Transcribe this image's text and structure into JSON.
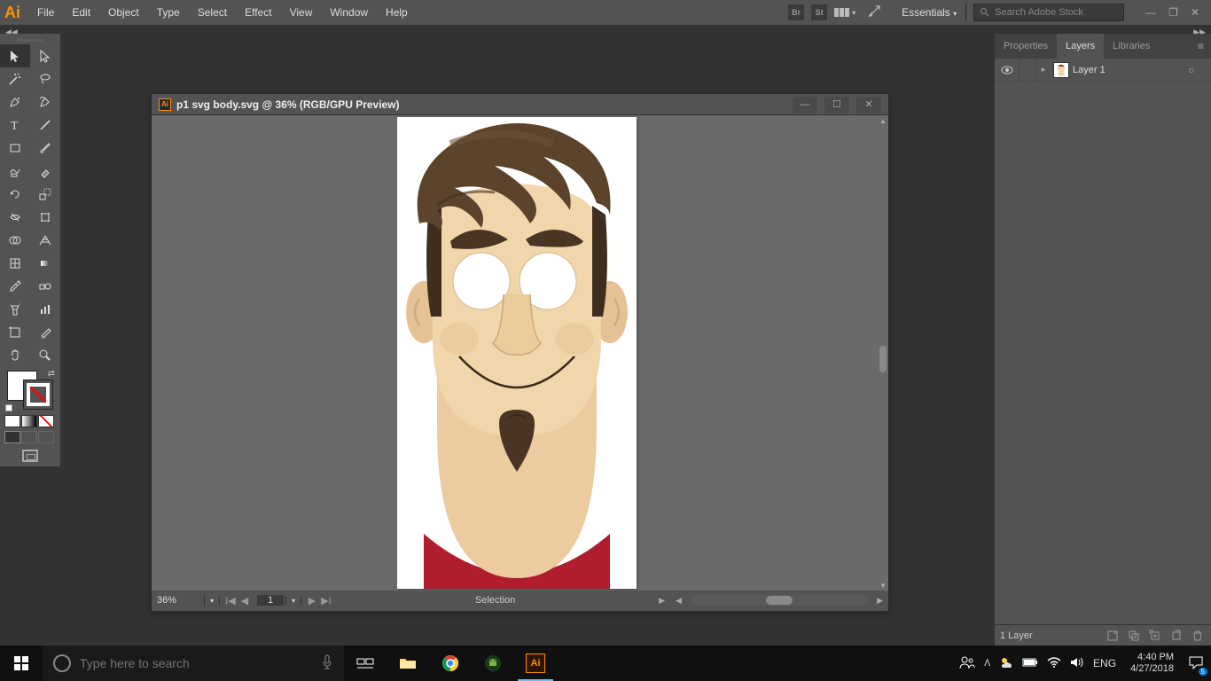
{
  "app": {
    "name": "Ai"
  },
  "menu": [
    "File",
    "Edit",
    "Object",
    "Type",
    "Select",
    "Effect",
    "View",
    "Window",
    "Help"
  ],
  "workspace": "Essentials",
  "search_placeholder": "Search Adobe Stock",
  "doc": {
    "title": "p1 svg body.svg @ 36% (RGB/GPU Preview)",
    "zoom": "36%",
    "page": "1",
    "status": "Selection"
  },
  "panel_tabs": {
    "properties": "Properties",
    "layers": "Layers",
    "libraries": "Libraries"
  },
  "layers": {
    "layer1": "Layer 1",
    "count": "1 Layer"
  },
  "taskbar": {
    "search_placeholder": "Type here to search",
    "lang": "ENG",
    "time": "4:40 PM",
    "date": "4/27/2018",
    "badge": "5"
  }
}
